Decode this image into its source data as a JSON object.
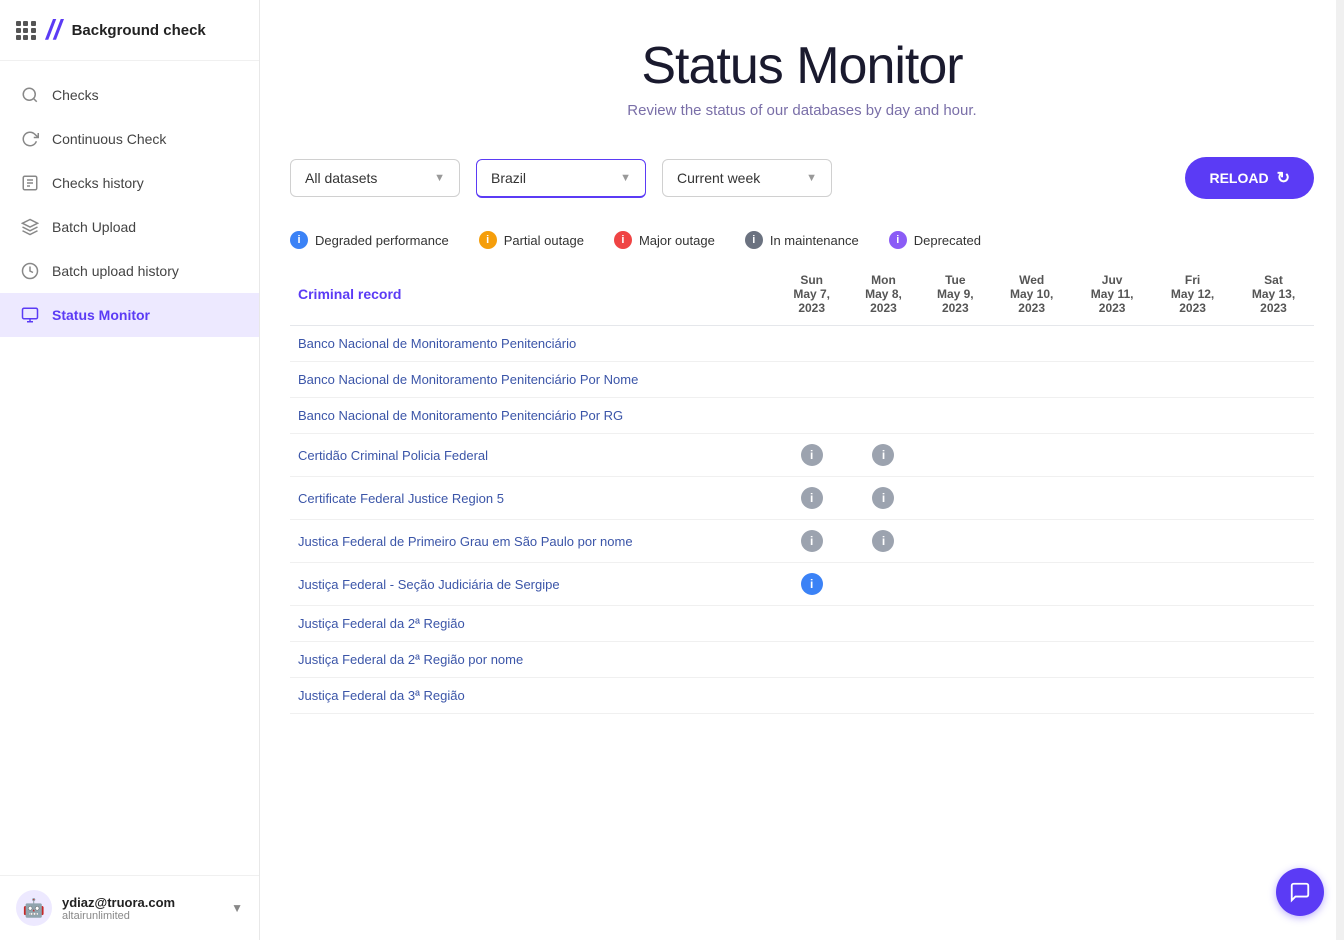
{
  "sidebar": {
    "app_name": "Background check",
    "logo": "//",
    "nav_items": [
      {
        "id": "checks",
        "label": "Checks",
        "icon": "search",
        "active": false
      },
      {
        "id": "continuous-check",
        "label": "Continuous Check",
        "icon": "refresh",
        "active": false
      },
      {
        "id": "checks-history",
        "label": "Checks history",
        "icon": "list",
        "active": false
      },
      {
        "id": "batch-upload",
        "label": "Batch Upload",
        "icon": "layers",
        "active": false
      },
      {
        "id": "batch-upload-history",
        "label": "Batch upload history",
        "icon": "clock",
        "active": false
      },
      {
        "id": "status-monitor",
        "label": "Status Monitor",
        "icon": "monitor",
        "active": true
      }
    ],
    "user": {
      "email": "ydiaz@truora.com",
      "org": "altairunlimited"
    }
  },
  "header": {
    "title": "Status Monitor",
    "subtitle": "Review the status of our databases by day and hour."
  },
  "filters": {
    "dataset": {
      "value": "All datasets",
      "placeholder": "All datasets"
    },
    "country": {
      "value": "Brazil",
      "placeholder": "Brazil"
    },
    "period": {
      "value": "Current week",
      "placeholder": "Current week"
    },
    "reload_label": "RELOAD"
  },
  "legend": [
    {
      "id": "degraded",
      "label": "Degraded performance",
      "color_class": "dot-blue"
    },
    {
      "id": "partial",
      "label": "Partial outage",
      "color_class": "dot-orange"
    },
    {
      "id": "major",
      "label": "Major outage",
      "color_class": "dot-red"
    },
    {
      "id": "maintenance",
      "label": "In maintenance",
      "color_class": "dot-gray"
    },
    {
      "id": "deprecated",
      "label": "Deprecated",
      "color_class": "dot-purple"
    }
  ],
  "table": {
    "section_label": "Criminal record",
    "columns": [
      {
        "id": "name",
        "label": ""
      },
      {
        "id": "sun",
        "label": "Sun\nMay 7,\n2023",
        "line1": "Sun",
        "line2": "May 7,",
        "line3": "2023"
      },
      {
        "id": "mon",
        "label": "Mon\nMay 8,\n2023",
        "line1": "Mon",
        "line2": "May 8,",
        "line3": "2023"
      },
      {
        "id": "tue",
        "label": "Tue\nMay 9,\n2023",
        "line1": "Tue",
        "line2": "May 9,",
        "line3": "2023"
      },
      {
        "id": "wed",
        "label": "Wed\nMay 10,\n2023",
        "line1": "Wed",
        "line2": "May 10,",
        "line3": "2023"
      },
      {
        "id": "juv",
        "label": "Juv\nMay 11,\n2023",
        "line1": "Juv",
        "line2": "May 11,",
        "line3": "2023"
      },
      {
        "id": "fri",
        "label": "Fri\nMay 12,\n2023",
        "line1": "Fri",
        "line2": "May 12,",
        "line3": "2023"
      },
      {
        "id": "sat",
        "label": "Sat\nMay 13,\n2023",
        "line1": "Sat",
        "line2": "May 13,",
        "line3": "2023"
      }
    ],
    "rows": [
      {
        "name": "Banco Nacional de Monitoramento Penitenciário",
        "sun": "",
        "mon": "",
        "tue": "",
        "wed": "",
        "juv": "",
        "fri": "",
        "sat": ""
      },
      {
        "name": "Banco Nacional de Monitoramento Penitenciário Por Nome",
        "sun": "",
        "mon": "",
        "tue": "",
        "wed": "",
        "juv": "",
        "fri": "",
        "sat": ""
      },
      {
        "name": "Banco Nacional de Monitoramento Penitenciário Por RG",
        "sun": "",
        "mon": "",
        "tue": "",
        "wed": "",
        "juv": "",
        "fri": "",
        "sat": ""
      },
      {
        "name": "Certidão Criminal Policia Federal",
        "sun": "gray",
        "mon": "gray",
        "tue": "",
        "wed": "",
        "juv": "",
        "fri": "",
        "sat": ""
      },
      {
        "name": "Certificate Federal Justice Region 5",
        "sun": "gray",
        "mon": "gray",
        "tue": "",
        "wed": "",
        "juv": "",
        "fri": "",
        "sat": ""
      },
      {
        "name": "Justica Federal de Primeiro Grau em São Paulo por nome",
        "sun": "gray",
        "mon": "gray",
        "tue": "",
        "wed": "",
        "juv": "",
        "fri": "",
        "sat": ""
      },
      {
        "name": "Justiça Federal - Seção Judiciária de Sergipe",
        "sun": "blue",
        "mon": "",
        "tue": "",
        "wed": "",
        "juv": "",
        "fri": "",
        "sat": ""
      },
      {
        "name": "Justiça Federal da 2ª Região",
        "sun": "",
        "mon": "",
        "tue": "",
        "wed": "",
        "juv": "",
        "fri": "",
        "sat": ""
      },
      {
        "name": "Justiça Federal da 2ª Região por nome",
        "sun": "",
        "mon": "",
        "tue": "",
        "wed": "",
        "juv": "",
        "fri": "",
        "sat": ""
      },
      {
        "name": "Justiça Federal da 3ª Região",
        "sun": "",
        "mon": "",
        "tue": "",
        "wed": "",
        "juv": "",
        "fri": "",
        "sat": ""
      }
    ]
  }
}
